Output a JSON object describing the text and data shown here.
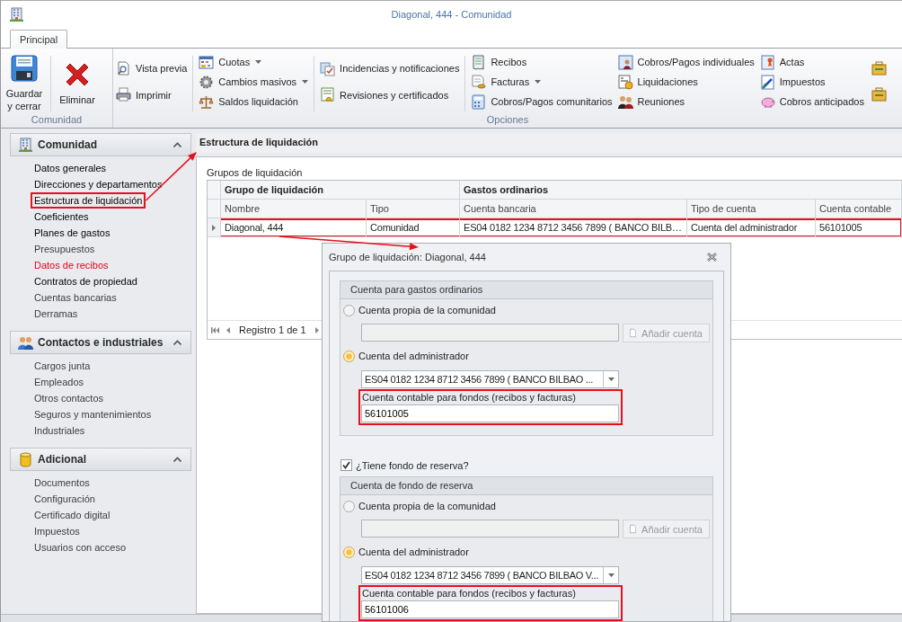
{
  "window": {
    "title": "Diagonal, 444 - Comunidad"
  },
  "ribbon_tabs": [
    {
      "label": "Principal",
      "selected": true
    }
  ],
  "ribbon_groups": [
    {
      "label": "Comunidad",
      "columns": [
        {
          "divider_before": false,
          "items": [
            {
              "label": "Guardar y cerrar",
              "kind": "large"
            }
          ]
        },
        {
          "divider_before": true,
          "items": [
            {
              "label": "Eliminar",
              "kind": "large"
            }
          ]
        }
      ]
    },
    {
      "label": "Opciones",
      "columns": [
        {
          "divider_before": false,
          "items": [
            {
              "label": "Vista previa",
              "kind": "small"
            },
            {
              "label": "Imprimir",
              "kind": "small"
            }
          ]
        },
        {
          "divider_before": true,
          "items": [
            {
              "label": "Cuotas",
              "kind": "menu"
            },
            {
              "label": "Cambios masivos",
              "kind": "menu"
            },
            {
              "label": "Saldos liquidación",
              "kind": "small"
            }
          ]
        },
        {
          "divider_before": true,
          "items": [
            {
              "label": "Incidencias y notificaciones",
              "kind": "small"
            },
            {
              "label": "Revisiones y certificados",
              "kind": "small"
            }
          ]
        },
        {
          "divider_before": true,
          "items": [
            {
              "label": "Recibos",
              "kind": "small"
            },
            {
              "label": "Facturas",
              "kind": "menu"
            },
            {
              "label": "Cobros/Pagos comunitarios",
              "kind": "small"
            }
          ]
        },
        {
          "divider_before": false,
          "items": [
            {
              "label": "Cobros/Pagos individuales",
              "kind": "small"
            },
            {
              "label": "Liquidaciones",
              "kind": "small"
            },
            {
              "label": "Reuniones",
              "kind": "small"
            }
          ]
        },
        {
          "divider_before": false,
          "items": [
            {
              "label": "Actas",
              "kind": "small"
            },
            {
              "label": "Impuestos",
              "kind": "small"
            },
            {
              "label": "Cobros anticipados",
              "kind": "small"
            }
          ]
        },
        {
          "divider_before": false,
          "items": [
            {
              "kind": "icon"
            },
            {
              "kind": "icon"
            }
          ]
        }
      ]
    }
  ],
  "sidebar": {
    "sections": [
      {
        "title": "Comunidad",
        "expanded": true,
        "items": [
          {
            "label": "Datos generales",
            "color": "#000000",
            "highlighted": false
          },
          {
            "label": "Direcciones y departamentos",
            "color": "#000000",
            "highlighted": false
          },
          {
            "label": "Estructura de liquidación",
            "color": "#000000",
            "highlighted": true
          },
          {
            "label": "Coeficientes",
            "color": "#000000",
            "highlighted": false
          },
          {
            "label": "Planes de gastos",
            "color": "#000000",
            "highlighted": false
          },
          {
            "label": "Presupuestos",
            "color": "#3c3c3c",
            "highlighted": false
          },
          {
            "label": "Datos de recibos",
            "color": "#e8001c",
            "highlighted": false
          },
          {
            "label": "Contratos de propiedad",
            "color": "#000000",
            "highlighted": false
          },
          {
            "label": "Cuentas bancarias",
            "color": "#3c3c3c",
            "highlighted": false
          },
          {
            "label": "Derramas",
            "color": "#3c3c3c",
            "highlighted": false
          }
        ]
      },
      {
        "title": "Contactos e industriales",
        "expanded": true,
        "items": [
          {
            "label": "Cargos junta",
            "color": "#3c3c3c",
            "highlighted": false
          },
          {
            "label": "Empleados",
            "color": "#3c3c3c",
            "highlighted": false
          },
          {
            "label": "Otros contactos",
            "color": "#3c3c3c",
            "highlighted": false
          },
          {
            "label": "Seguros y mantenimientos",
            "color": "#3c3c3c",
            "highlighted": false
          },
          {
            "label": "Industriales",
            "color": "#3c3c3c",
            "highlighted": false
          }
        ]
      },
      {
        "title": "Adicional",
        "expanded": true,
        "items": [
          {
            "label": "Documentos",
            "color": "#3c3c3c",
            "highlighted": false
          },
          {
            "label": "Configuración",
            "color": "#3c3c3c",
            "highlighted": false
          },
          {
            "label": "Certificado digital",
            "color": "#3c3c3c",
            "highlighted": false
          },
          {
            "label": "Impuestos",
            "color": "#3c3c3c",
            "highlighted": false
          },
          {
            "label": "Usuarios con acceso",
            "color": "#3c3c3c",
            "highlighted": false
          }
        ]
      }
    ]
  },
  "content": {
    "title": "Estructura de liquidación",
    "group_label": "Grupos de liquidación",
    "table": {
      "column_groups": [
        {
          "label": "Grupo de liquidación",
          "columns": [
            "Nombre",
            "Tipo"
          ]
        },
        {
          "label": "Gastos ordinarios",
          "columns": [
            "Cuenta bancaria",
            "Tipo de cuenta",
            "Cuenta contable"
          ]
        }
      ],
      "rows": [
        {
          "cells": [
            "Diagonal, 444",
            "Comunidad",
            "ES04 0182 1234 8712 3456 7899 ( BANCO BILB…",
            "Cuenta del administrador",
            "56101005"
          ],
          "selected": true,
          "highlighted": true
        }
      ],
      "navigator": "Registro 1 de 1"
    }
  },
  "dialog": {
    "title": "Grupo de liquidación: Diagonal, 444",
    "reserve_checkbox": {
      "label": "¿Tiene fondo de reserva?",
      "checked": true
    },
    "groups": [
      {
        "title": "Cuenta para gastos ordinarios",
        "options": [
          {
            "label": "Cuenta propia de la comunidad",
            "selected": false
          },
          {
            "label": "Cuenta del administrador",
            "selected": true
          }
        ],
        "add_button": {
          "label": "Añadir cuenta",
          "disabled": true
        },
        "account": "ES04 0182 1234 8712 3456 7899 ( BANCO BILBAO ...",
        "field_label": "Cuenta contable para fondos (recibos y facturas)",
        "field_value": "56101005",
        "highlighted": true
      },
      {
        "title": "Cuenta de fondo de reserva",
        "options": [
          {
            "label": "Cuenta propia de la comunidad",
            "selected": false
          },
          {
            "label": "Cuenta del administrador",
            "selected": true
          }
        ],
        "add_button": {
          "label": "Añadir cuenta",
          "disabled": true
        },
        "account": "ES04 0182 1234 8712 3456 7899 ( BANCO BILBAO V...",
        "field_label": "Cuenta contable para fondos (recibos y facturas)",
        "field_value": "56101006",
        "highlighted": true
      }
    ]
  }
}
